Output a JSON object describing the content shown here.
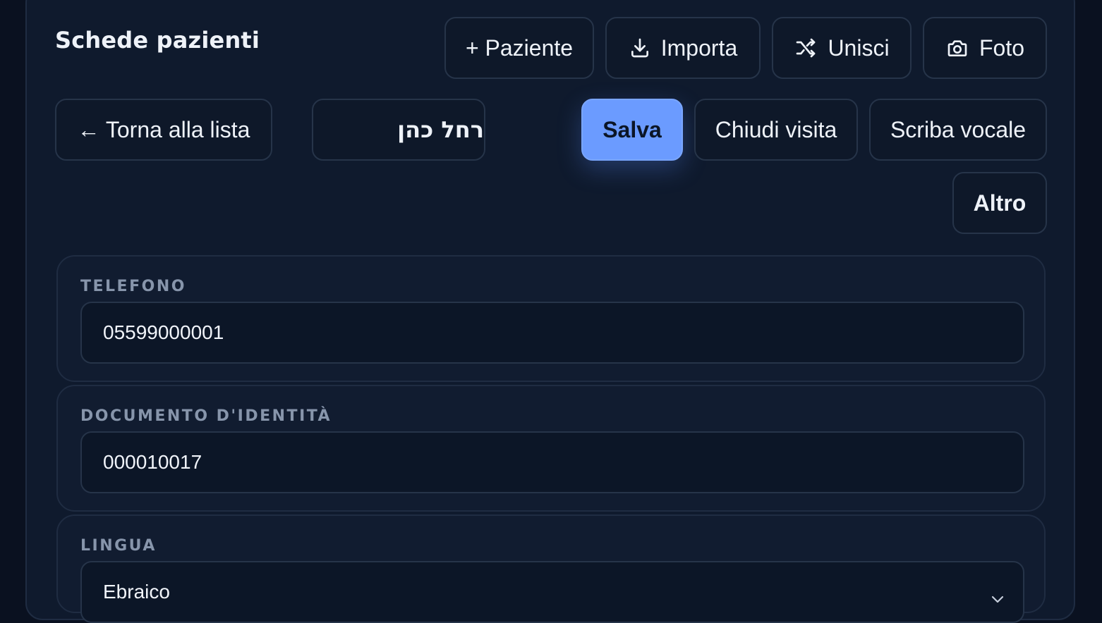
{
  "header": {
    "title": "Schede pazienti",
    "actions": [
      {
        "label": "+ Paziente",
        "icon": null
      },
      {
        "label": "Importa",
        "icon": "download-icon"
      },
      {
        "label": "Unisci",
        "icon": "shuffle-merge-icon"
      },
      {
        "label": "Foto",
        "icon": "camera-icon"
      }
    ]
  },
  "toolbar": {
    "back_label": "← Torna alla lista",
    "patient_name": "רחל כהן",
    "save_label": "Salva",
    "close_visit_label": "Chiudi visita",
    "voice_scribe_label": "Scriba vocale",
    "more_label": "Altro"
  },
  "form": {
    "phone": {
      "label": "TELEFONO",
      "value": "05599000001"
    },
    "id_document": {
      "label": "DOCUMENTO D'IDENTITÀ",
      "value": "000010017"
    },
    "language": {
      "label": "LINGUA",
      "value": "Ebraico"
    }
  },
  "colors": {
    "background": "#0a1120",
    "panel": "#0f1a2d",
    "accent": "#6b9bff",
    "label": "#8795ab"
  }
}
